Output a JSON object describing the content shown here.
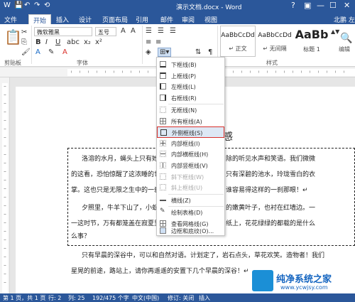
{
  "titlebar": {
    "title": "演示文档.docx - Word",
    "qa_icons": [
      "W",
      "💾",
      "↶",
      "↷",
      "⟲"
    ],
    "window_controls": [
      "?",
      "▣",
      "—",
      "☐",
      "✕"
    ]
  },
  "tabs": [
    "文件",
    "开始",
    "插入",
    "设计",
    "页面布局",
    "引用",
    "邮件",
    "审阅",
    "视图"
  ],
  "user": "北鹏 左",
  "ribbon": {
    "clipboard_label": "剪贴板",
    "font_label": "字体",
    "styles_label": "样式",
    "edit_label": "编辑",
    "font_name": "微软雅黑",
    "font_size": "五号",
    "styles": [
      {
        "preview": "AaBbCcDd",
        "name": "↵ 正文"
      },
      {
        "preview": "AaBbCcDd",
        "name": "↵ 无间隔"
      },
      {
        "preview": "AaBb",
        "name": "标题 1"
      }
    ]
  },
  "menu": {
    "items": [
      {
        "label": "下框线(B)",
        "disabled": false
      },
      {
        "label": "上框线(P)",
        "disabled": false
      },
      {
        "label": "左框线(L)",
        "disabled": false
      },
      {
        "label": "右框线(R)",
        "disabled": false
      },
      {
        "label": "无框线(N)",
        "disabled": false
      },
      {
        "label": "所有框线(A)",
        "disabled": false
      },
      {
        "label": "外侧框线(S)",
        "disabled": false,
        "highlighted": true
      },
      {
        "label": "内部框线(I)",
        "disabled": false
      },
      {
        "label": "内部横框线(H)",
        "disabled": false
      },
      {
        "label": "内部竖框线(V)",
        "disabled": false
      },
      {
        "label": "斜下框线(W)",
        "disabled": true
      },
      {
        "label": "斜上框线(U)",
        "disabled": true
      },
      {
        "label": "横线(Z)",
        "disabled": false
      },
      {
        "label": "绘制表格(D)",
        "disabled": false
      },
      {
        "label": "查看网格线(G)",
        "disabled": false
      },
      {
        "label": "边框和底纹(O)...",
        "disabled": false
      }
    ]
  },
  "document": {
    "heading": "杂感",
    "heading_prefix": "论",
    "lines": [
      "洛溶的水月，蝇头上只有她",
      "的这看，恐怕惊醒了这浓睡的世界",
      "掌。这也只是无限之生中的一刹那",
      "夕照里，牛羊下山了，小蚁",
      "一这时节，万有都笼盖在寂夏里，",
      "么事？"
    ],
    "lines_right": [
      "除的听见水声和笑语。我们微微",
      "只有深碧的池水，玲珑雪白的衣",
      "谁容易得这样的一刹那眼！↵",
      "的嫩黄叶子，也衬在红墙边。一",
      "纸上，花花绿绿的都载的是什么",
      ""
    ],
    "after": [
      "只有早晨的深谷中，可以和自然对语。计划定了，岩石点头，草花欢笑。造物者！我们",
      "星晃的前途，路站上，请你再遥遥的安置下几个早晨的深谷！↵"
    ]
  },
  "status": {
    "page": "第 1 页，共 1 页",
    "words": "192/475 个字",
    "lang": "中文(中国)",
    "track": "修订: 关闭",
    "mode": "插入",
    "row": "行: 2",
    "col": "列: 25"
  },
  "watermark": {
    "title": "纯净系统之家",
    "url": "www.ycwjsy.com"
  },
  "colors": {
    "accent": "#2b579a",
    "highlight": "#d9302b"
  }
}
